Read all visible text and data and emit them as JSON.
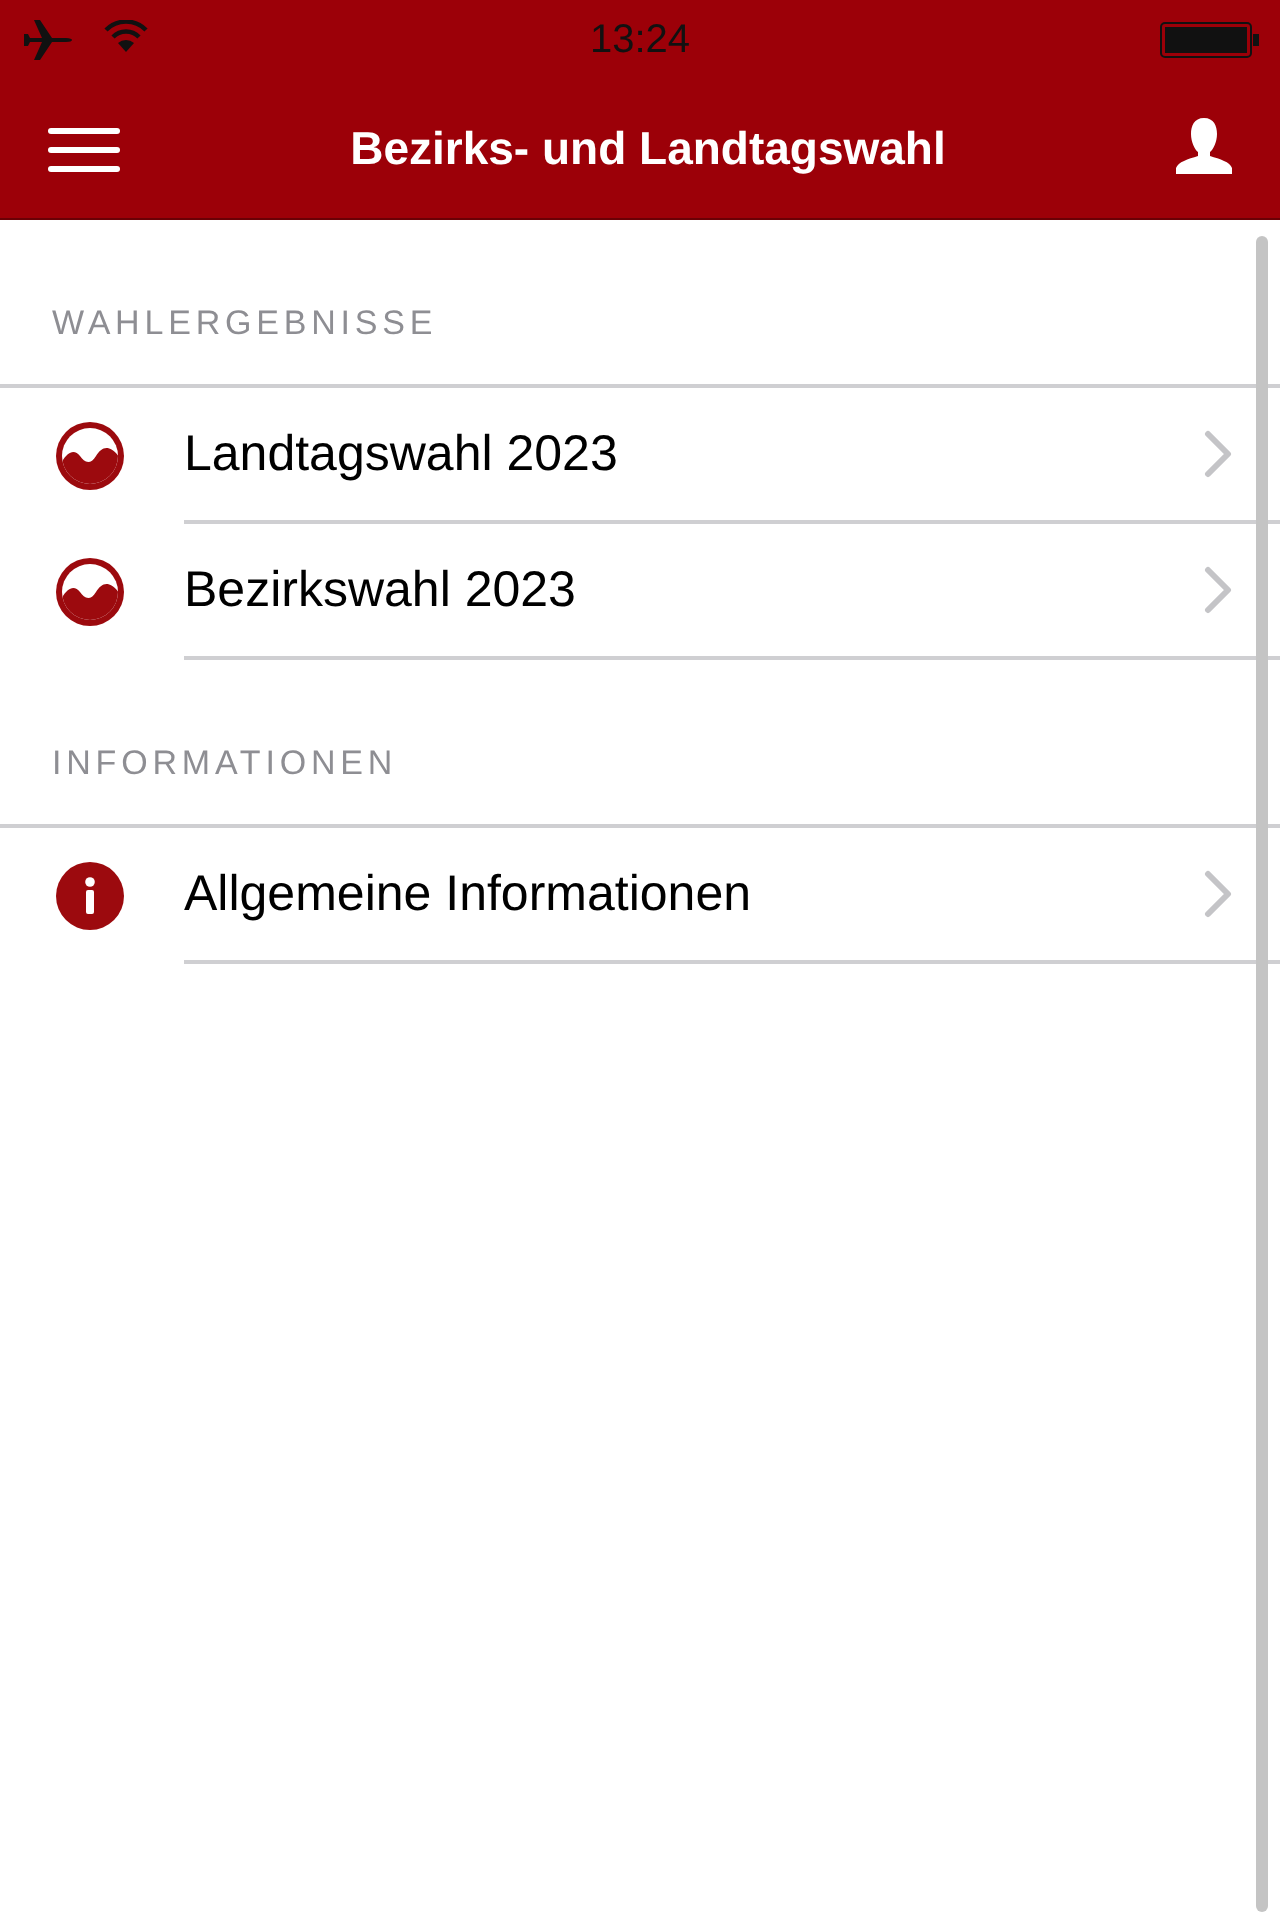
{
  "status_bar": {
    "time": "13:24"
  },
  "nav_bar": {
    "title": "Bezirks- und Landtagswahl"
  },
  "sections": [
    {
      "header": "WAHLERGEBNISSE",
      "items": [
        {
          "label": "Landtagswahl 2023",
          "kind": "election"
        },
        {
          "label": "Bezirkswahl 2023",
          "kind": "election"
        }
      ]
    },
    {
      "header": "INFORMATIONEN",
      "items": [
        {
          "label": "Allgemeine Informationen",
          "kind": "info"
        }
      ]
    }
  ]
}
